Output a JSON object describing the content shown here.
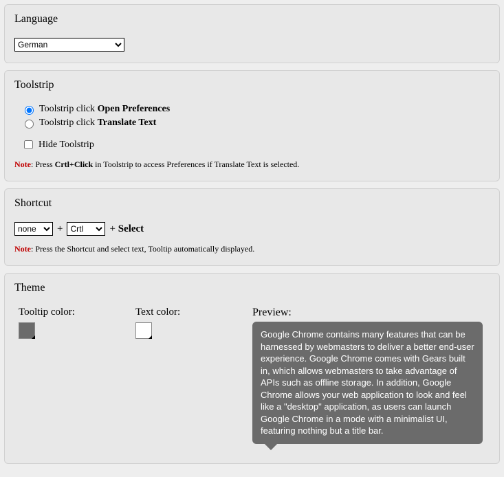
{
  "language": {
    "title": "Language",
    "selected": "German"
  },
  "toolstrip": {
    "title": "Toolstrip",
    "radio_prefix": "Toolstrip click ",
    "radio_open_pref": "Open Preferences",
    "radio_translate": "Translate Text",
    "hide_label": "Hide Toolstrip",
    "note_label": "Note",
    "note_text": ": Press ",
    "note_keys": "Crtl+Click",
    "note_rest": " in Toolstrip to access Preferences if Translate Text is selected."
  },
  "shortcut": {
    "title": "Shortcut",
    "sel1": "none",
    "sel2": "Crtl",
    "plus": "+",
    "select_label": "Select",
    "note_label": "Note",
    "note_text": ": Press the Shortcut and select text, Tooltip automatically displayed."
  },
  "theme": {
    "title": "Theme",
    "tooltip_color_label": "Tooltip color:",
    "text_color_label": "Text color:",
    "tooltip_color": "#6b6b6b",
    "text_color": "#ffffff",
    "preview_label": "Preview:",
    "preview_text": "Google Chrome contains many features that can be harnessed by webmasters to deliver a better end-user experience. Google Chrome comes with Gears built in, which allows webmasters to take advantage of APIs such as offline storage. In addition, Google Chrome allows your web application to look and feel like a \"desktop\" application, as users can launch Google Chrome in a mode with a minimalist UI, featuring nothing but a title bar."
  }
}
